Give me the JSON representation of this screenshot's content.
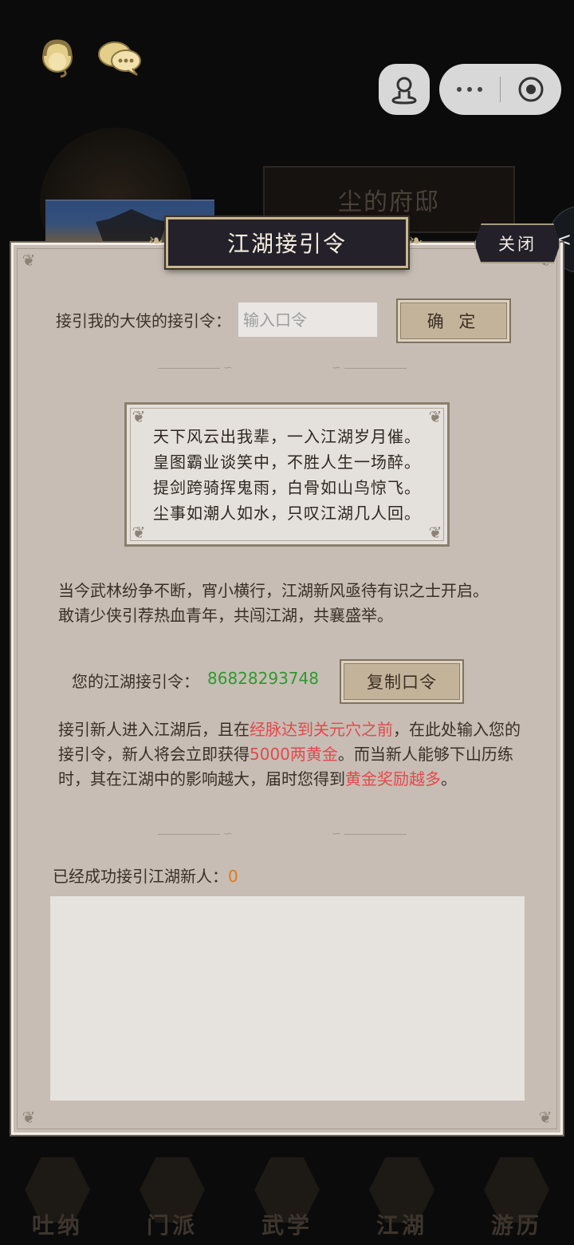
{
  "background": {
    "mansion_label": "尘的府邸",
    "nav": [
      "吐纳",
      "门派",
      "武学",
      "江湖",
      "游历"
    ]
  },
  "top_icons": [
    "customer-service-icon",
    "chat-bubbles-icon"
  ],
  "capsule": {
    "avatar_icon": "user-avatar-icon",
    "more_icon": "more-dots-icon",
    "close_icon": "target-circle-icon"
  },
  "side_peek": {
    "label": "<"
  },
  "modal": {
    "title": "江湖接引令",
    "close_label": "关闭",
    "code_label": "接引我的大侠的接引令：",
    "code_placeholder": "输入口令",
    "confirm_label": "确 定",
    "poem": [
      "天下风云出我辈，一入江湖岁月催。",
      "皇图霸业谈笑中，不胜人生一场醉。",
      "提剑跨骑挥鬼雨，白骨如山鸟惊飞。",
      "尘事如潮人如水，只叹江湖几人回。"
    ],
    "intro": [
      "当今武林纷争不断，宵小横行，江湖新风亟待有识之士开启。",
      "敢请少侠引荐热血青年，共闯江湖，共襄盛举。"
    ],
    "my_code_label": "您的江湖接引令：",
    "my_code_value": "86828293748",
    "copy_label": "复制口令",
    "rule": {
      "p1": "接引新人进入江湖后，且在",
      "h1": "经脉达到关元穴之前",
      "p2": "，在此处输入您的接引令，新人将会立即获得",
      "h2": "5000两黄金",
      "p3": "。而当新人能够下山历练时，其在江湖中的影响越大，届时您得到",
      "h3": "黄金奖励越多",
      "p4": "。"
    },
    "success_label": "已经成功接引江湖新人：",
    "success_count": "0"
  },
  "colors": {
    "accent_green": "#2d9a2d",
    "highlight_red": "#e24a4a",
    "count_orange": "#e07a1a"
  }
}
